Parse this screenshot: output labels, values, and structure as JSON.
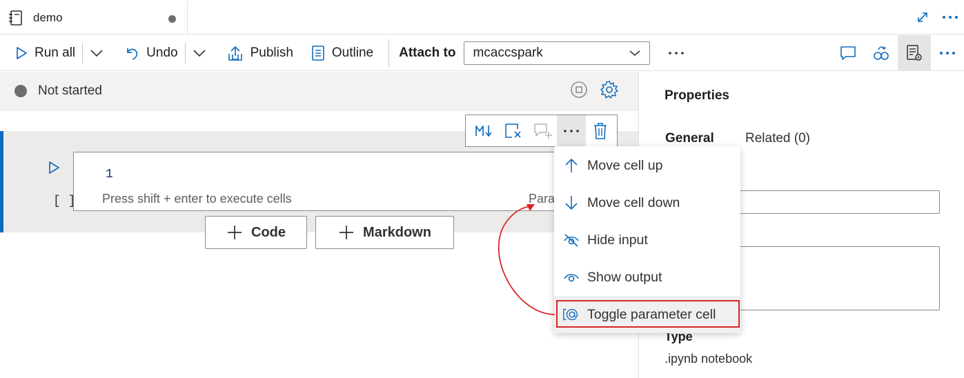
{
  "tab": {
    "title": "demo"
  },
  "toolbar": {
    "run_all": "Run all",
    "undo": "Undo",
    "publish": "Publish",
    "outline": "Outline",
    "attach_label": "Attach to",
    "attach_value": "mcaccspark"
  },
  "status": {
    "text": "Not started"
  },
  "cell": {
    "line_number": "1",
    "exec_count": "[ ]",
    "hint": "Press shift + enter to execute cells",
    "parameters_tag": "Parameters"
  },
  "add_buttons": {
    "code": "Code",
    "markdown": "Markdown"
  },
  "context_menu": {
    "items": [
      {
        "label": "Move cell up",
        "icon": "arrow-up-icon"
      },
      {
        "label": "Move cell down",
        "icon": "arrow-down-icon"
      },
      {
        "label": "Hide input",
        "icon": "eye-off-icon"
      },
      {
        "label": "Show output",
        "icon": "eye-icon"
      },
      {
        "label": "Toggle parameter cell",
        "icon": "parameter-icon"
      }
    ]
  },
  "properties": {
    "title": "Properties",
    "tabs": {
      "general": "General",
      "related": "Related (0)"
    },
    "type_label": "Type",
    "type_value": ".ipynb notebook"
  },
  "colors": {
    "accent": "#0f6cbd",
    "highlight_outline": "#d92424"
  }
}
